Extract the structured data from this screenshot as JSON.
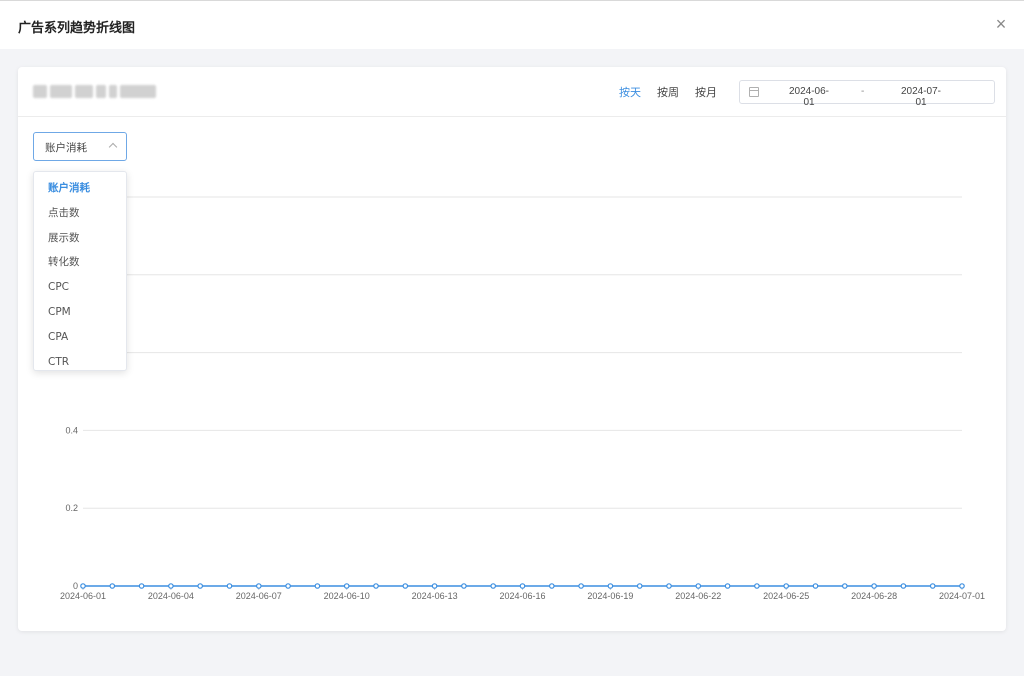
{
  "modal": {
    "title": "广告系列趋势折线图",
    "close_glyph": "×"
  },
  "toolbar": {
    "tabs": [
      {
        "label": "按天",
        "active": true
      },
      {
        "label": "按周",
        "active": false
      },
      {
        "label": "按月",
        "active": false
      }
    ],
    "date_range": {
      "start": "2024-06-01",
      "separator": "-",
      "end": "2024-07-01",
      "icon": "calendar-icon"
    }
  },
  "metric_select": {
    "value": "账户消耗",
    "options": [
      "账户消耗",
      "点击数",
      "展示数",
      "转化数",
      "CPC",
      "CPM",
      "CPA",
      "CTR"
    ],
    "selected_index": 0
  },
  "colors": {
    "accent": "#3b8ee0",
    "line": "#3b8ee0",
    "grid": "#e6e6e6"
  },
  "chart_data": {
    "type": "line",
    "title": "",
    "xlabel": "",
    "ylabel": "",
    "ylim": [
      0,
      1
    ],
    "y_ticks": [
      "0",
      "0.2",
      "0.4"
    ],
    "x_tick_labels": [
      "2024-06-01",
      "2024-06-04",
      "2024-06-07",
      "2024-06-10",
      "2024-06-13",
      "2024-06-16",
      "2024-06-19",
      "2024-06-22",
      "2024-06-25",
      "2024-06-28",
      "2024-07-01"
    ],
    "x": [
      "2024-06-01",
      "2024-06-02",
      "2024-06-03",
      "2024-06-04",
      "2024-06-05",
      "2024-06-06",
      "2024-06-07",
      "2024-06-08",
      "2024-06-09",
      "2024-06-10",
      "2024-06-11",
      "2024-06-12",
      "2024-06-13",
      "2024-06-14",
      "2024-06-15",
      "2024-06-16",
      "2024-06-17",
      "2024-06-18",
      "2024-06-19",
      "2024-06-20",
      "2024-06-21",
      "2024-06-22",
      "2024-06-23",
      "2024-06-24",
      "2024-06-25",
      "2024-06-26",
      "2024-06-27",
      "2024-06-28",
      "2024-06-29",
      "2024-06-30",
      "2024-07-01"
    ],
    "series": [
      {
        "values": [
          0,
          0,
          0,
          0,
          0,
          0,
          0,
          0,
          0,
          0,
          0,
          0,
          0,
          0,
          0,
          0,
          0,
          0,
          0,
          0,
          0,
          0,
          0,
          0,
          0,
          0,
          0,
          0,
          0,
          0,
          0
        ]
      }
    ],
    "grid": true,
    "legend": "none"
  }
}
